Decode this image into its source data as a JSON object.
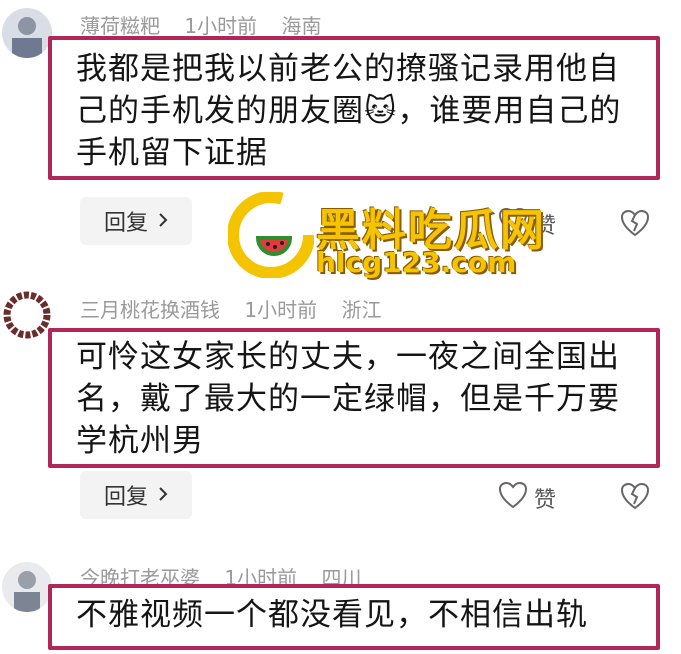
{
  "comments": [
    {
      "username": "薄荷糍粑",
      "time": "1小时前",
      "location": "海南",
      "text": "我都是把我以前老公的撩骚记录用他自己的手机发的朋友圈🐱，谁要用自己的手机留下证据",
      "reply_label": "回复",
      "like_label": "赞"
    },
    {
      "username": "三月桃花换酒钱",
      "time": "1小时前",
      "location": "浙江",
      "text": "可怜这女家长的丈夫，一夜之间全国出名，戴了最大的一定绿帽，但是千万要学杭州男",
      "reply_label": "回复",
      "like_label": "赞"
    },
    {
      "username": "今晚打老巫婆",
      "time": "1小时前",
      "location": "四川",
      "text": "不雅视频一个都没看见，不相信出轨"
    }
  ],
  "watermark": {
    "title": "黑料吃瓜网",
    "url": "hlcg123.com"
  },
  "colors": {
    "highlight_border": "#b2275a",
    "meta_text": "#9a9a9a",
    "reply_bg": "#f3f3f3",
    "watermark_yellow": "#f5c400"
  },
  "icons": [
    "heart-icon",
    "broken-heart-icon",
    "chevron-right-icon",
    "watermelon-logo-icon"
  ]
}
